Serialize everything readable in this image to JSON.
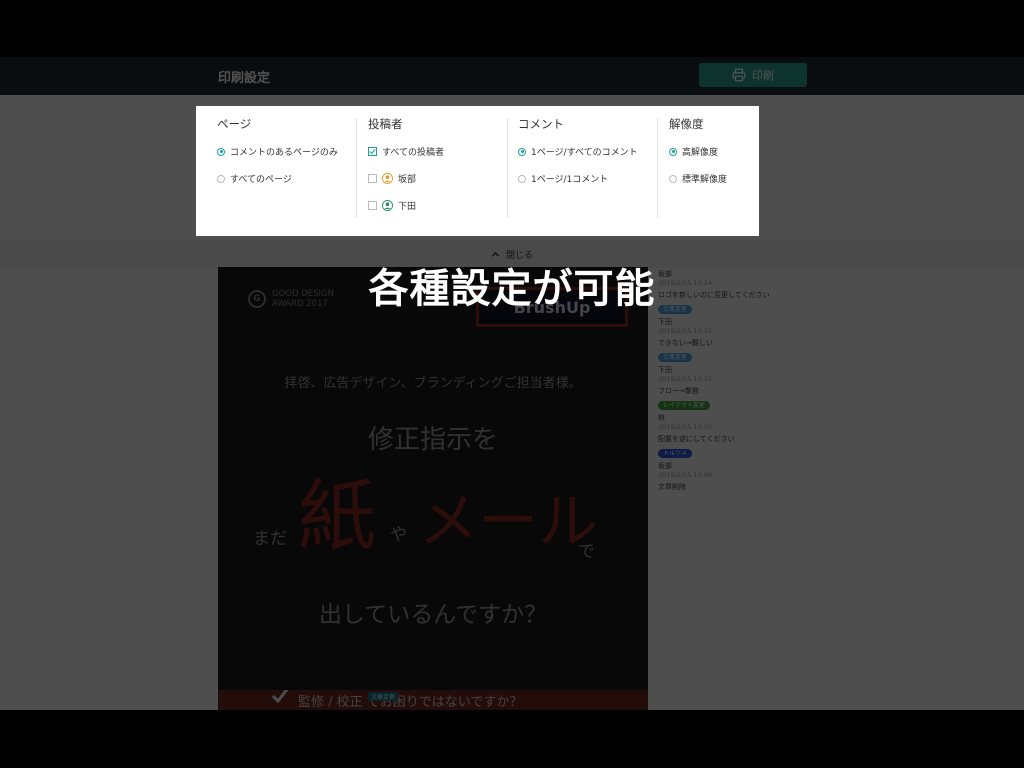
{
  "header": {
    "title": "印刷設定",
    "print_label": "印刷"
  },
  "settings": {
    "page": {
      "title": "ページ",
      "options": [
        "コメントのあるページのみ",
        "すべてのページ"
      ],
      "selected": 0
    },
    "poster": {
      "title": "投稿者",
      "options": [
        "すべての投稿者",
        "坂部",
        "下田"
      ],
      "checked": [
        true,
        false,
        false
      ]
    },
    "comment": {
      "title": "コメント",
      "options": [
        "1ページ/すべてのコメント",
        "1ページ/1コメント"
      ],
      "selected": 0
    },
    "resolution": {
      "title": "解像度",
      "options": [
        "高解像度",
        "標準解像度"
      ],
      "selected": 0
    }
  },
  "close_label": "閉じる",
  "document": {
    "award_text": "GOOD DESIGN\nAWARD 2017",
    "award_mark": "G",
    "brand": "BrushUp",
    "line1": "拝啓、広告デザイン、ブランディングご担当者様。",
    "line2": "修正指示を",
    "mada": "まだ",
    "kami": "紙",
    "ya": "や",
    "mail": "メール",
    "de": "で",
    "line3": "出しているんですか？",
    "bottom_text": "監修 / 校正 でお困りではないですか？",
    "bottom_tag": "文章変更"
  },
  "comments": [
    {
      "name": "坂部",
      "time": "2019/2/25 13:14",
      "text": "ロゴを新しいのに変更してください"
    },
    {
      "tag": "文章変更",
      "tag_color": "#4aa3e0",
      "name": "下田",
      "time": "2019/2/25 13:12",
      "text": "できない→難しい"
    },
    {
      "tag": "文章変更",
      "tag_color": "#4aa3e0",
      "name": "下田",
      "time": "2019/2/25 13:12",
      "text": "フロー→業務"
    },
    {
      "tag": "レイアウト変更",
      "tag_color": "#3ca03c",
      "name": "林",
      "time": "2019/2/25 13:10",
      "text": "配置を逆にしてください"
    },
    {
      "tag": "トルツメ",
      "tag_color": "#2a56d8",
      "name": "坂部",
      "time": "2019/2/25 13:06",
      "text": "文章削除"
    }
  ],
  "caption": "各種設定が可能",
  "colors": {
    "accent": "#27a38b",
    "header_bg": "#1e2a33",
    "brand_red": "#8a2a1f"
  }
}
